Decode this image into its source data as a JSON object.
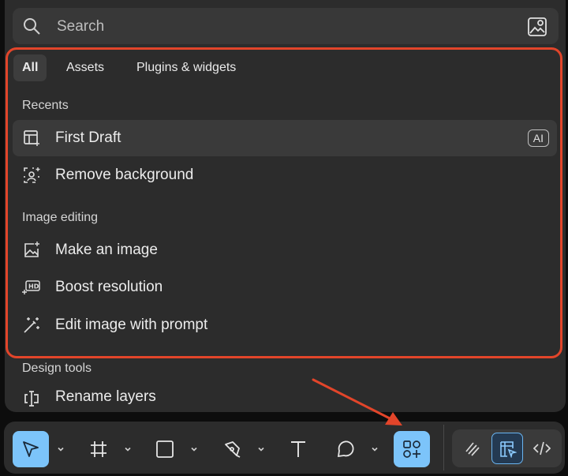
{
  "search": {
    "placeholder": "Search"
  },
  "tabs": [
    {
      "label": "All",
      "active": true
    },
    {
      "label": "Assets",
      "active": false
    },
    {
      "label": "Plugins & widgets",
      "active": false
    }
  ],
  "sections": {
    "recents": "Recents",
    "image_editing": "Image editing",
    "design_tools": "Design tools"
  },
  "items": {
    "first_draft": {
      "label": "First Draft",
      "badge": "AI",
      "icon": "layout-ai-icon"
    },
    "remove_background": {
      "label": "Remove background",
      "icon": "remove-bg-icon"
    },
    "make_image": {
      "label": "Make an image",
      "icon": "image-sparkle-icon"
    },
    "boost_resolution": {
      "label": "Boost resolution",
      "icon": "hd-icon"
    },
    "edit_image_prompt": {
      "label": "Edit image with prompt",
      "icon": "magic-wand-icon"
    },
    "rename_layers": {
      "label": "Rename layers",
      "icon": "rename-icon"
    }
  },
  "toolbar": {
    "tools": [
      "move-tool",
      "frame-tool",
      "shape-tool",
      "pen-tool",
      "text-tool",
      "comment-tool",
      "actions-tool"
    ],
    "modes": [
      "draw-mode",
      "design-mode",
      "dev-mode"
    ]
  },
  "colors": {
    "panel": "#2c2c2c",
    "highlight": "#e2452a",
    "accent": "#7cc4fa",
    "arrow": "#e2452a"
  }
}
